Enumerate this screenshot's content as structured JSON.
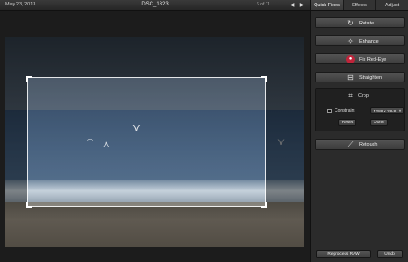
{
  "toolbar": {
    "date": "May 23, 2013",
    "title": "DSC_1823",
    "count": "6 of 11",
    "prev_label": "◀",
    "next_label": "▶"
  },
  "panel": {
    "tabs": [
      {
        "label": "Quick Fixes",
        "active": true
      },
      {
        "label": "Effects",
        "active": false
      },
      {
        "label": "Adjust",
        "active": false
      }
    ],
    "tools": {
      "rotate": {
        "label": "Rotate",
        "icon": "rotate-icon"
      },
      "enhance": {
        "label": "Enhance",
        "icon": "magic-wand-icon"
      },
      "fix_red_eye": {
        "label": "Fix Red-Eye",
        "icon": "red-eye-icon"
      },
      "straighten": {
        "label": "Straighten",
        "icon": "straighten-icon"
      },
      "retouch": {
        "label": "Retouch",
        "icon": "bandage-icon"
      }
    },
    "crop": {
      "label": "Crop",
      "icon": "crop-icon",
      "constrain_label": "Constrain:",
      "constrain_checked": false,
      "constrain_value": "4288 x 2848",
      "reset_label": "Reset",
      "done_label": "Done"
    },
    "reprocess_label": "Reprocess RAW",
    "undo_label": "Undo"
  },
  "colors": {
    "background": "#1f1f1f",
    "panel": "#2b2b2b",
    "button_top": "#545454",
    "red_eye": "#c0243a"
  }
}
